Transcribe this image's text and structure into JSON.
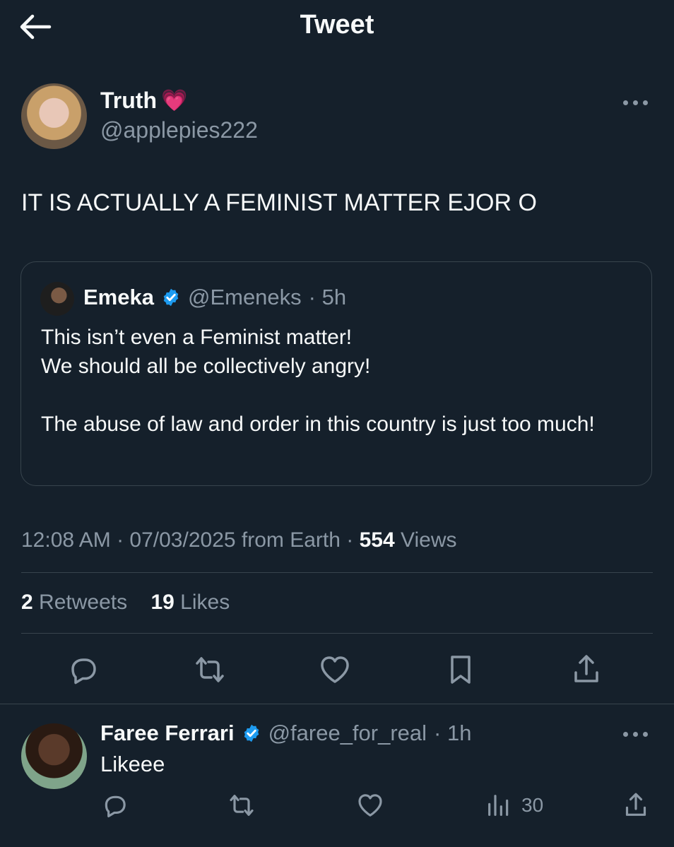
{
  "header": {
    "title": "Tweet"
  },
  "tweet": {
    "author_name": "Truth",
    "author_emoji": "💗",
    "author_handle": "@applepies222",
    "text": "IT IS ACTUALLY A FEMINIST MATTER EJOR O",
    "quote": {
      "name": "Emeka",
      "handle": "@Emeneks",
      "time": "· 5h",
      "text": "This isn’t even a Feminist matter!\nWe should all be collectively angry!\n\nThe abuse of law and order in this country is just too much!"
    },
    "timestamp": "12:08 AM · 07/03/2025 from Earth ·",
    "views_count": "554",
    "views_label": "Views",
    "retweets_count": "2",
    "retweets_label": "Retweets",
    "likes_count": "19",
    "likes_label": "Likes"
  },
  "reply": {
    "name": "Faree Ferrari",
    "handle": "@faree_for_real",
    "time": "· 1h",
    "text": "Likeee",
    "views": "30"
  },
  "colors": {
    "background": "#15202b",
    "muted": "#8b98a5",
    "verified": "#1d9bf0",
    "heart": "#ff5fa8"
  }
}
